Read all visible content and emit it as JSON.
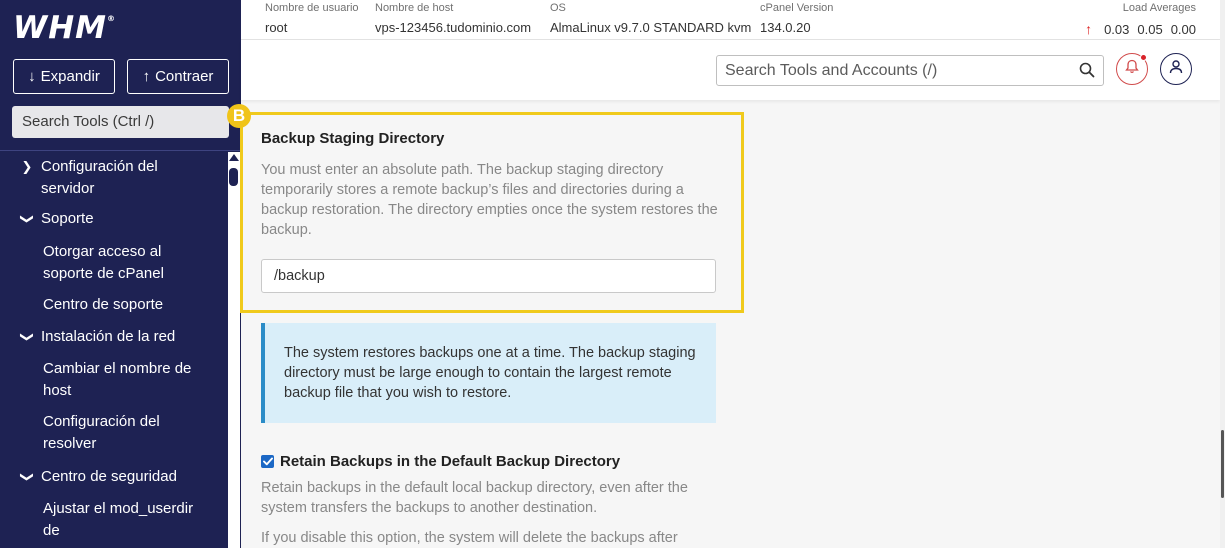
{
  "sidebar": {
    "logo": "WHM",
    "logo_mark": "®",
    "expand_label": "Expandir",
    "collapse_label": "Contraer",
    "search_placeholder": "Search Tools (Ctrl /)",
    "items": [
      {
        "label": "Configuración del servidor",
        "state": "collapsed"
      },
      {
        "label": "Soporte",
        "state": "expanded"
      },
      {
        "label": "Otorgar acceso al soporte de cPanel",
        "level": 2
      },
      {
        "label": "Centro de soporte",
        "level": 2
      },
      {
        "label": "Instalación de la red",
        "state": "expanded"
      },
      {
        "label": "Cambiar el nombre de host",
        "level": 2
      },
      {
        "label": "Configuración del resolver",
        "level": 2
      },
      {
        "label": "Centro de seguridad",
        "state": "expanded"
      },
      {
        "label": "Ajustar el mod_userdir de",
        "level": 2
      }
    ]
  },
  "topbar": {
    "username_key": "Nombre de usuario",
    "username": "root",
    "hostname_key": "Nombre de host",
    "hostname": "vps-123456.tudominio.com",
    "os_key": "OS",
    "os": "AlmaLinux v9.7.0 STANDARD kvm",
    "cpanel_key": "cPanel Version",
    "cpanel": "134.0.20",
    "loads_key": "Load Averages",
    "loads": [
      "0.03",
      "0.05",
      "0.00"
    ]
  },
  "header": {
    "search_placeholder": "Search Tools and Accounts (/)"
  },
  "main": {
    "badge": "B",
    "section_title": "Backup Staging Directory",
    "section_desc": "You must enter an absolute path. The backup staging directory temporarily stores a remote backup’s files and directories during a backup restoration. The directory empties once the system restores the backup.",
    "path_value": "/backup",
    "info_text": "The system restores backups one at a time. The backup staging directory must be large enough to contain the largest remote backup file that you wish to restore.",
    "retain_label": "Retain Backups in the Default Backup Directory",
    "retain_checked": true,
    "retain_desc": "Retain backups in the default local backup directory, even after the system transfers the backups to another destination.",
    "retain_desc2": "If you disable this option, the system will delete the backups after"
  },
  "colors": {
    "sidebar_bg": "#1e2253",
    "highlight": "#f0ca1c",
    "info_bg": "#d9eef9",
    "info_border": "#2b8cc7",
    "checkbox": "#1c68c5",
    "alert_red": "#d8232a"
  }
}
